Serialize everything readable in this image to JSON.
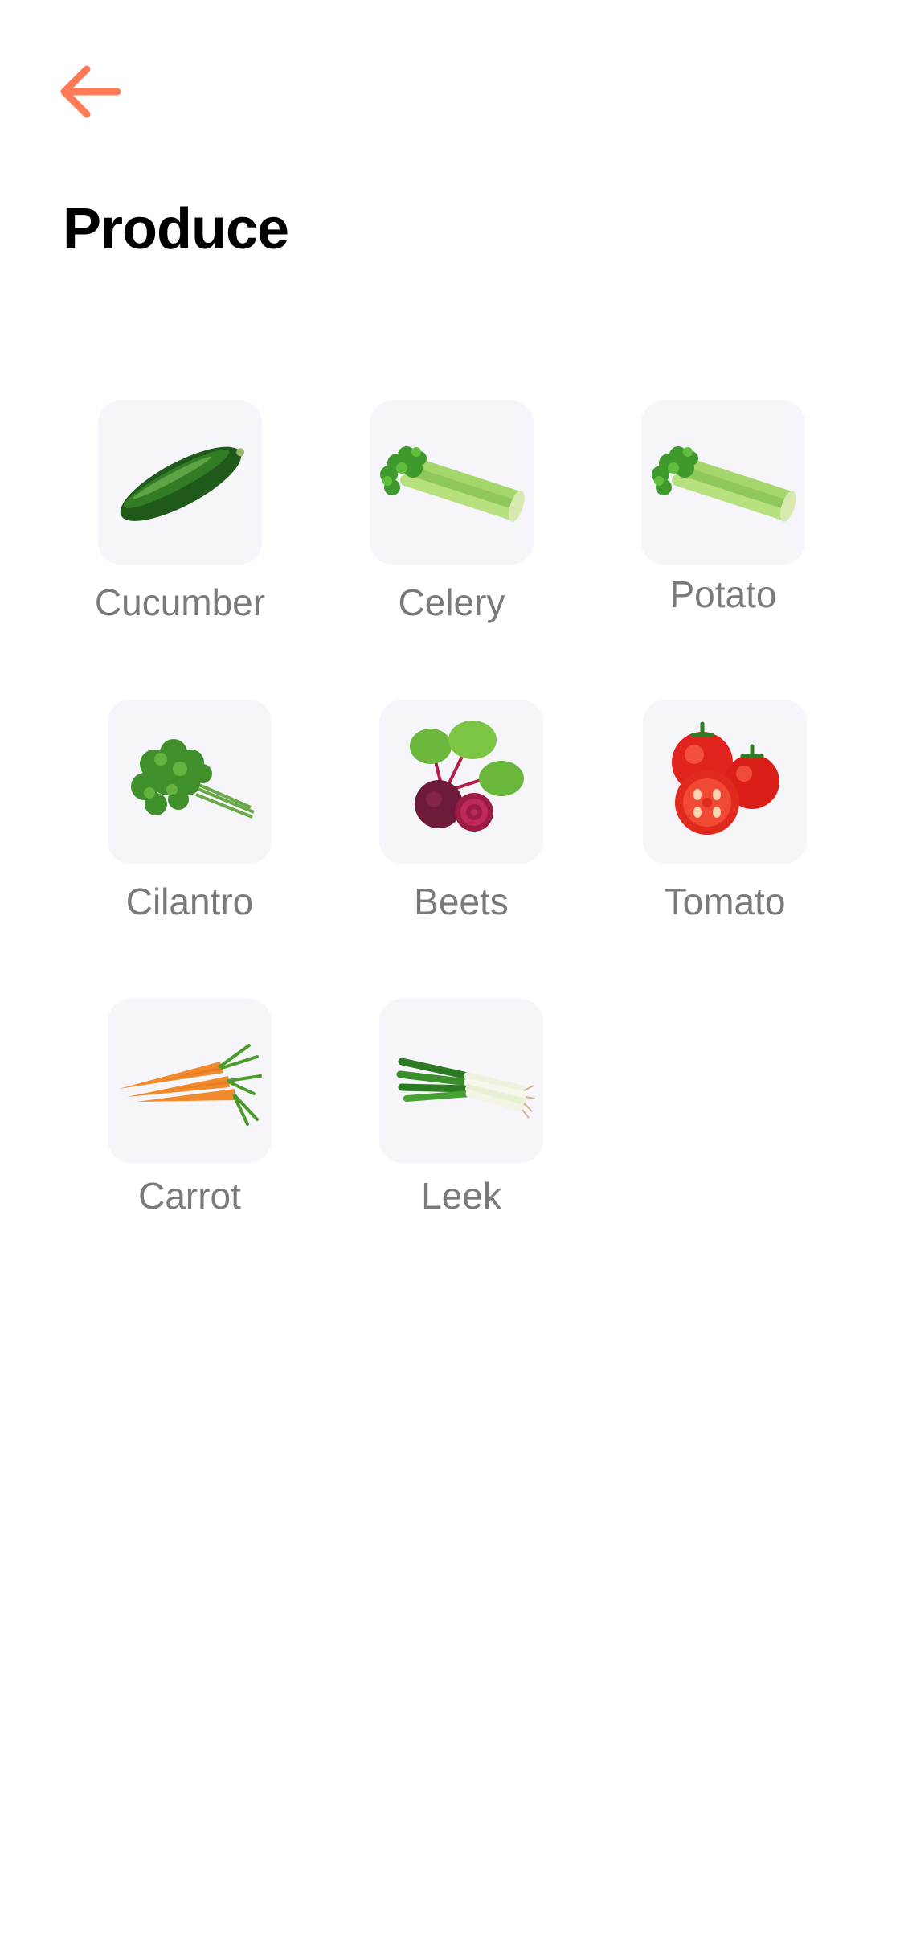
{
  "header": {
    "back_icon": "arrow-left-icon",
    "title": "Produce"
  },
  "accent_color": "#ff7a55",
  "produce_items": [
    {
      "label": "Cucumber",
      "icon": "cucumber-icon"
    },
    {
      "label": "Celery",
      "icon": "celery-icon"
    },
    {
      "label": "Potato",
      "icon": "celery-icon"
    },
    {
      "label": "Cilantro",
      "icon": "cilantro-icon"
    },
    {
      "label": "Beets",
      "icon": "beets-icon"
    },
    {
      "label": "Tomato",
      "icon": "tomato-icon"
    },
    {
      "label": "Carrot",
      "icon": "carrot-icon"
    },
    {
      "label": "Leek",
      "icon": "leek-icon"
    }
  ]
}
